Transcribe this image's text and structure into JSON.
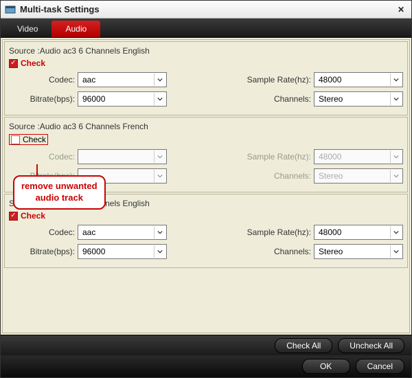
{
  "window": {
    "title": "Multi-task Settings"
  },
  "tabs": {
    "video": "Video",
    "audio": "Audio",
    "active": "audio"
  },
  "labels": {
    "check": "Check",
    "codec": "Codec:",
    "bitrate": "Bitrate(bps):",
    "samplerate": "Sample Rate(hz):",
    "channels": "Channels:"
  },
  "annotation": {
    "line1": "remove unwanted",
    "line2": "audio track"
  },
  "tracks": [
    {
      "source": "Source :Audio  ac3  6 Channels  English",
      "checked": true,
      "enabled": true,
      "codec": "aac",
      "bitrate": "96000",
      "samplerate": "48000",
      "channels": "Stereo"
    },
    {
      "source": "Source :Audio  ac3  6 Channels  French",
      "checked": false,
      "enabled": false,
      "codec": "",
      "bitrate": "",
      "samplerate": "48000",
      "channels": "Stereo"
    },
    {
      "source": "Source :Audio  ac3  2 Channels  English",
      "checked": true,
      "enabled": true,
      "codec": "aac",
      "bitrate": "96000",
      "samplerate": "48000",
      "channels": "Stereo"
    }
  ],
  "buttons": {
    "checkall": "Check All",
    "uncheckall": "Uncheck All",
    "ok": "OK",
    "cancel": "Cancel"
  }
}
